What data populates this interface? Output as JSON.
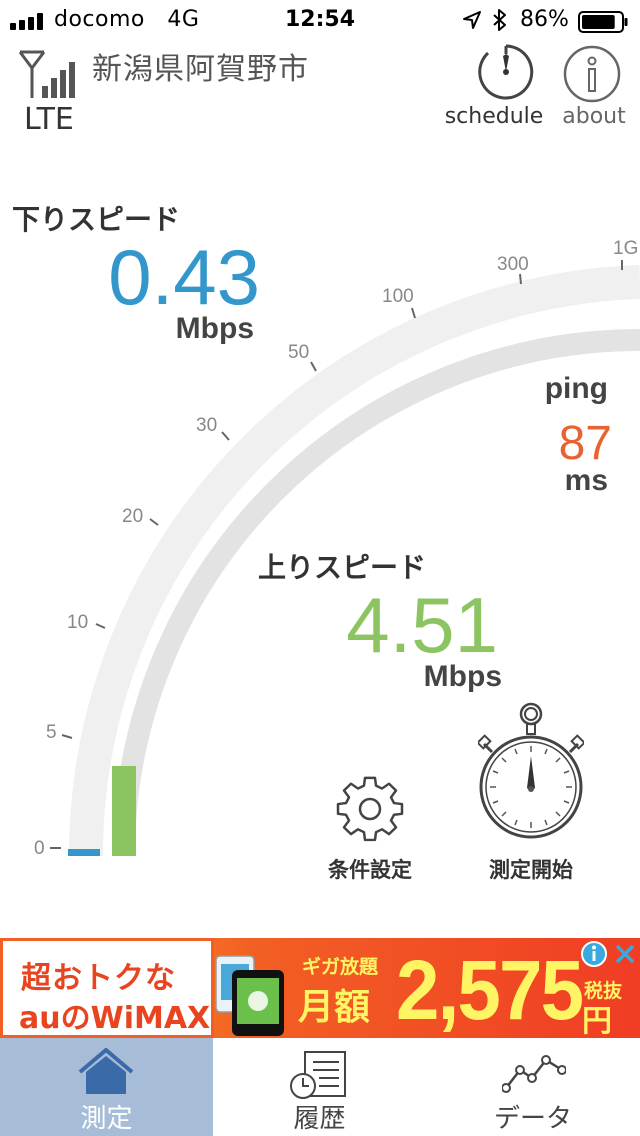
{
  "status_bar": {
    "carrier": "docomo",
    "network": "4G",
    "time": "12:54",
    "battery_pct": "86%",
    "signal_bars": 4,
    "battery_level": 0.86
  },
  "header": {
    "network_type": "LTE",
    "location": "新潟県阿賀野市",
    "schedule_label": "schedule",
    "about_label": "about"
  },
  "gauge": {
    "tick_labels": [
      "0",
      "5",
      "10",
      "20",
      "30",
      "50",
      "100",
      "300",
      "1G"
    ],
    "download_fill_mbps": 0.43,
    "upload_fill_mbps": 4.51
  },
  "download": {
    "label": "下りスピード",
    "value": "0.43",
    "unit": "Mbps"
  },
  "ping": {
    "label": "ping",
    "value": "87",
    "unit": "ms"
  },
  "upload": {
    "label": "上りスピード",
    "value": "4.51",
    "unit": "Mbps"
  },
  "actions": {
    "settings_label": "条件設定",
    "start_label": "測定開始"
  },
  "ad": {
    "line1": "超おトクな",
    "line2": "auのWiMAX",
    "tag": "ギガ放題",
    "monthly": "月額",
    "price": "2,575",
    "tax": "税抜",
    "yen": "円",
    "phone_badge": "ギガ放題"
  },
  "tabs": [
    {
      "label": "測定",
      "active": true
    },
    {
      "label": "履歴",
      "active": false
    },
    {
      "label": "データ",
      "active": false
    }
  ],
  "colors": {
    "download": "#3397cc",
    "upload": "#8dc462",
    "ping": "#e86332",
    "active_tab": "#a6bcd7",
    "ad_orange": "#f25f24",
    "ad_yellow": "#fff463"
  }
}
